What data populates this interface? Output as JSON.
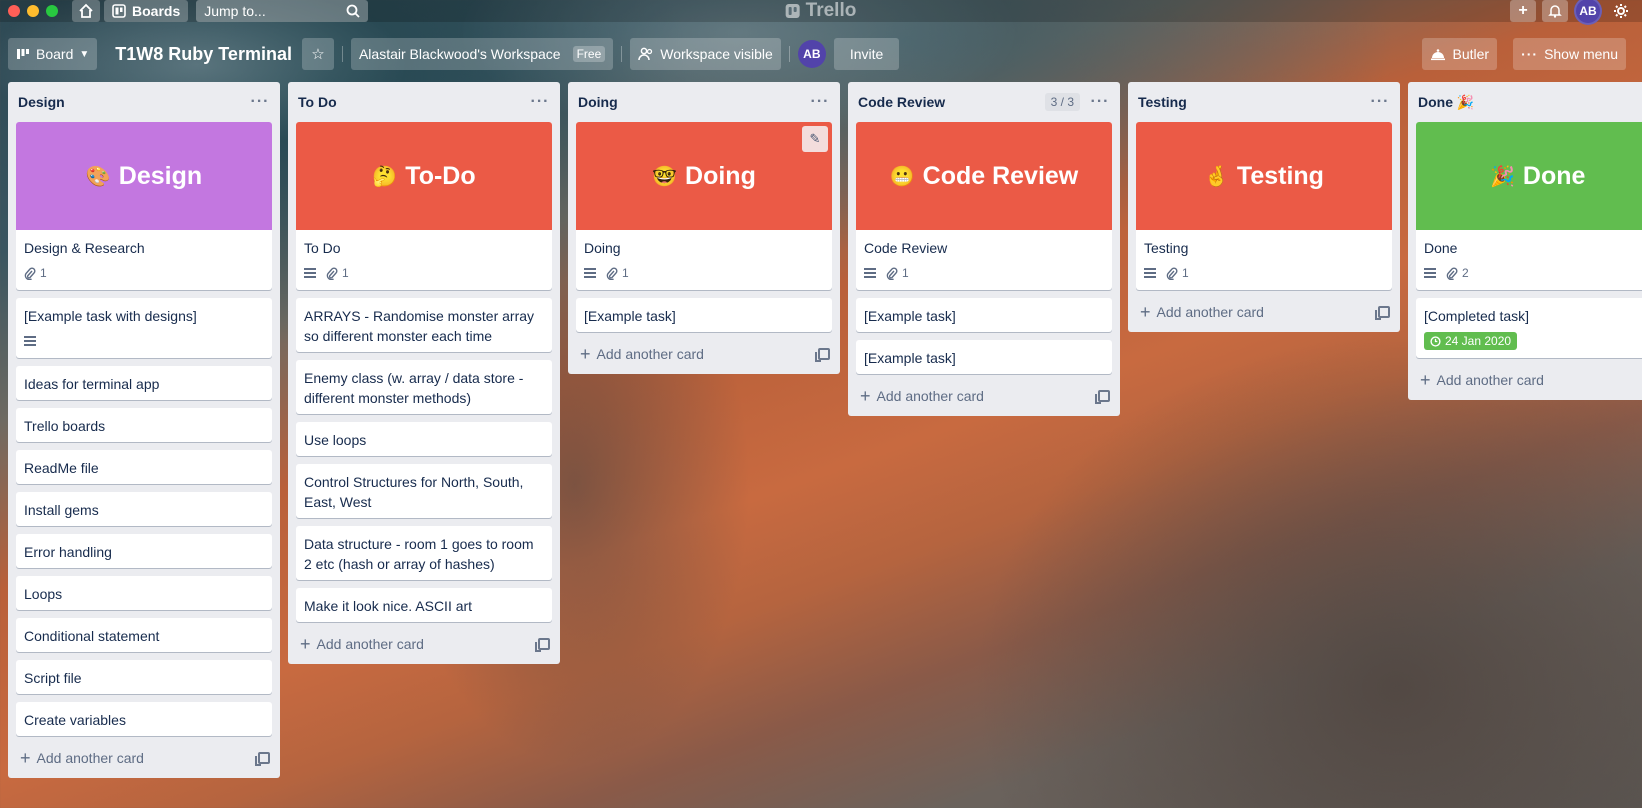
{
  "topbar": {
    "boards_label": "Boards",
    "jump_placeholder": "Jump to...",
    "app_name": "Trello",
    "user_initials": "AB"
  },
  "board": {
    "view_label": "Board",
    "title": "T1W8 Ruby Terminal",
    "workspace_name": "Alastair Blackwood's Workspace",
    "workspace_plan": "Free",
    "visibility_label": "Workspace visible",
    "member_initials": "AB",
    "invite_label": "Invite",
    "butler_label": "Butler",
    "menu_label": "Show menu"
  },
  "add_card_label": "Add another card",
  "lists": [
    {
      "title": "Design",
      "cards": [
        {
          "cover_text": "Design",
          "cover_emoji": "🎨",
          "cover_color": "#c377e0",
          "title": "Design & Research",
          "desc": false,
          "attachments": "1"
        },
        {
          "title": "[Example task with designs]",
          "desc": true
        },
        {
          "title": "Ideas for terminal app"
        },
        {
          "title": "Trello boards"
        },
        {
          "title": "ReadMe file"
        },
        {
          "title": "Install gems"
        },
        {
          "title": "Error handling"
        },
        {
          "title": "Loops"
        },
        {
          "title": "Conditional statement"
        },
        {
          "title": "Script file"
        },
        {
          "title": "Create variables"
        }
      ]
    },
    {
      "title": "To Do",
      "cards": [
        {
          "cover_text": "To-Do",
          "cover_emoji": "🤔",
          "cover_color": "#eb5a46",
          "title": "To Do",
          "desc": true,
          "attachments": "1"
        },
        {
          "title": "ARRAYS - Randomise monster array so different monster each time"
        },
        {
          "title": "Enemy class (w. array / data store - different monster methods)"
        },
        {
          "title": "Use loops"
        },
        {
          "title": "Control Structures for North, South, East, West"
        },
        {
          "title": "Data structure - room 1 goes to room 2 etc (hash or array of hashes)"
        },
        {
          "title": "Make it look nice. ASCII art"
        }
      ]
    },
    {
      "title": "Doing",
      "cards": [
        {
          "cover_text": "Doing",
          "cover_emoji": "🤓",
          "cover_color": "#eb5a46",
          "title": "Doing",
          "desc": true,
          "attachments": "1",
          "edit_icon": true
        },
        {
          "title": "[Example task]"
        }
      ]
    },
    {
      "title": "Code Review",
      "limit": "3 / 3",
      "cards": [
        {
          "cover_text": "Code Review",
          "cover_emoji": "😬",
          "cover_color": "#eb5a46",
          "title": "Code Review",
          "desc": true,
          "attachments": "1"
        },
        {
          "title": "[Example task]"
        },
        {
          "title": "[Example task]"
        }
      ]
    },
    {
      "title": "Testing",
      "cards": [
        {
          "cover_text": "Testing",
          "cover_emoji": "🤞",
          "cover_color": "#eb5a46",
          "title": "Testing",
          "desc": true,
          "attachments": "1"
        }
      ]
    },
    {
      "title": "Done 🎉",
      "cards": [
        {
          "cover_text": "Done",
          "cover_emoji": "🎉",
          "cover_color": "#61bd4f",
          "title": "Done",
          "desc": true,
          "attachments": "2"
        },
        {
          "title": "[Completed task]",
          "due": "24 Jan 2020"
        }
      ]
    }
  ]
}
